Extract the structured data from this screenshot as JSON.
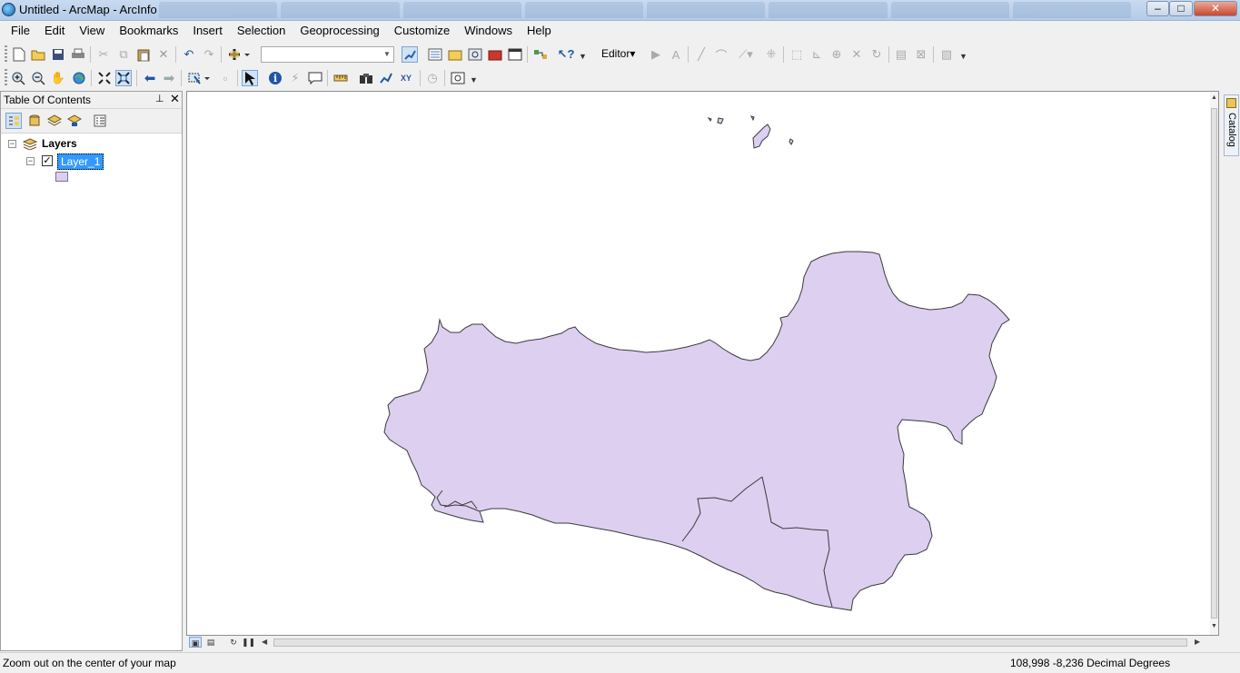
{
  "window": {
    "title": "Untitled - ArcMap - ArcInfo",
    "minimize": "–",
    "maximize": "□",
    "close": "✕"
  },
  "menu": [
    "File",
    "Edit",
    "View",
    "Bookmarks",
    "Insert",
    "Selection",
    "Geoprocessing",
    "Customize",
    "Windows",
    "Help"
  ],
  "toolbar": {
    "editor_label": "Editor▾",
    "layer_combo_value": ""
  },
  "toc": {
    "title": "Table Of Contents",
    "root_label": "Layers",
    "layer": {
      "name": "Layer_1",
      "checked": true,
      "fill_color": "#dccff0",
      "outline_color": "#3b3b3b"
    }
  },
  "catalog_tab": {
    "label": "Catalog"
  },
  "status": {
    "message": "Zoom out on the center of your map",
    "coordinates": "108,998  -8,236 Decimal Degrees"
  }
}
